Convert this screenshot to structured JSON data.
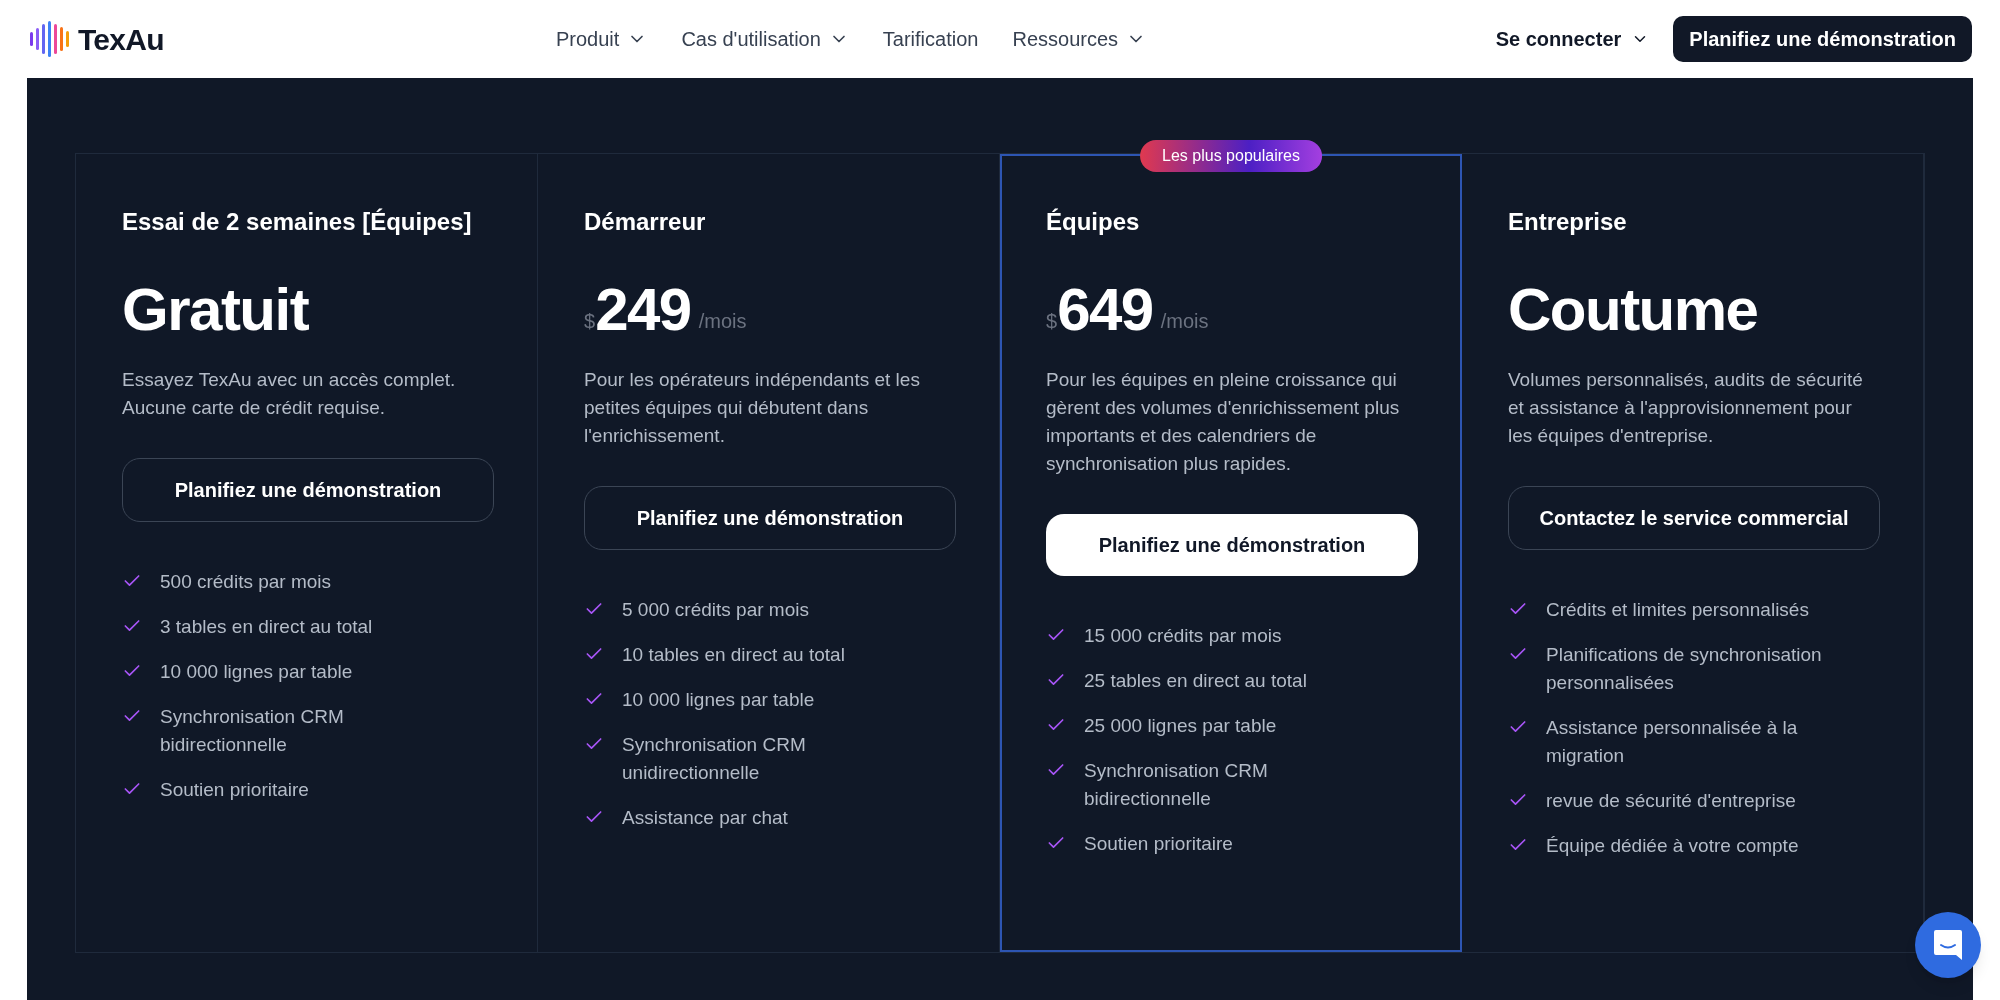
{
  "header": {
    "brand": "TexAu",
    "nav": [
      {
        "label": "Produit",
        "dropdown": true
      },
      {
        "label": "Cas d'utilisation",
        "dropdown": true
      },
      {
        "label": "Tarification",
        "dropdown": false
      },
      {
        "label": "Ressources",
        "dropdown": true
      }
    ],
    "login": {
      "label": "Se connecter",
      "dropdown": true
    },
    "cta": "Planifiez une démonstration"
  },
  "plans": [
    {
      "name": "Essai de 2 semaines [Équipes]",
      "price": {
        "kind": "text",
        "text": "Gratuit"
      },
      "description": "Essayez TexAu avec un accès complet. Aucune carte de crédit requise.",
      "button": "Planifiez une démonstration",
      "highlighted": false,
      "features": [
        "500 crédits par mois",
        "3 tables en direct au total",
        "10 000 lignes par table",
        "Synchronisation CRM bidirectionnelle",
        "Soutien prioritaire"
      ]
    },
    {
      "name": "Démarreur",
      "price": {
        "kind": "amount",
        "currency": "$",
        "amount": "249",
        "period": "/mois"
      },
      "description": "Pour les opérateurs indépendants et les petites équipes qui débutent dans l'enrichissement.",
      "button": "Planifiez une démonstration",
      "highlighted": false,
      "features": [
        "5 000 crédits par mois",
        "10 tables en direct au total",
        "10 000 lignes par table",
        "Synchronisation CRM unidirectionnelle",
        "Assistance par chat"
      ]
    },
    {
      "name": "Équipes",
      "badge": "Les plus populaires",
      "price": {
        "kind": "amount",
        "currency": "$",
        "amount": "649",
        "period": "/mois"
      },
      "description": "Pour les équipes en pleine croissance qui gèrent des volumes d'enrichissement plus importants et des calendriers de synchronisation plus rapides.",
      "button": "Planifiez une démonstration",
      "highlighted": true,
      "features": [
        "15 000 crédits par mois",
        "25 tables en direct au total",
        "25 000 lignes par table",
        "Synchronisation CRM bidirectionnelle",
        "Soutien prioritaire"
      ]
    },
    {
      "name": "Entreprise",
      "price": {
        "kind": "text",
        "text": "Coutume"
      },
      "description": "Volumes personnalisés, audits de sécurité et assistance à l'approvisionnement pour les équipes d'entreprise.",
      "button": "Contactez le service commercial",
      "highlighted": false,
      "features": [
        "Crédits et limites personnalisés",
        "Planifications de synchronisation personnalisées",
        "Assistance personnalisée à la migration",
        "revue de sécurité d'entreprise",
        "Équipe dédiée à votre compte"
      ]
    }
  ]
}
